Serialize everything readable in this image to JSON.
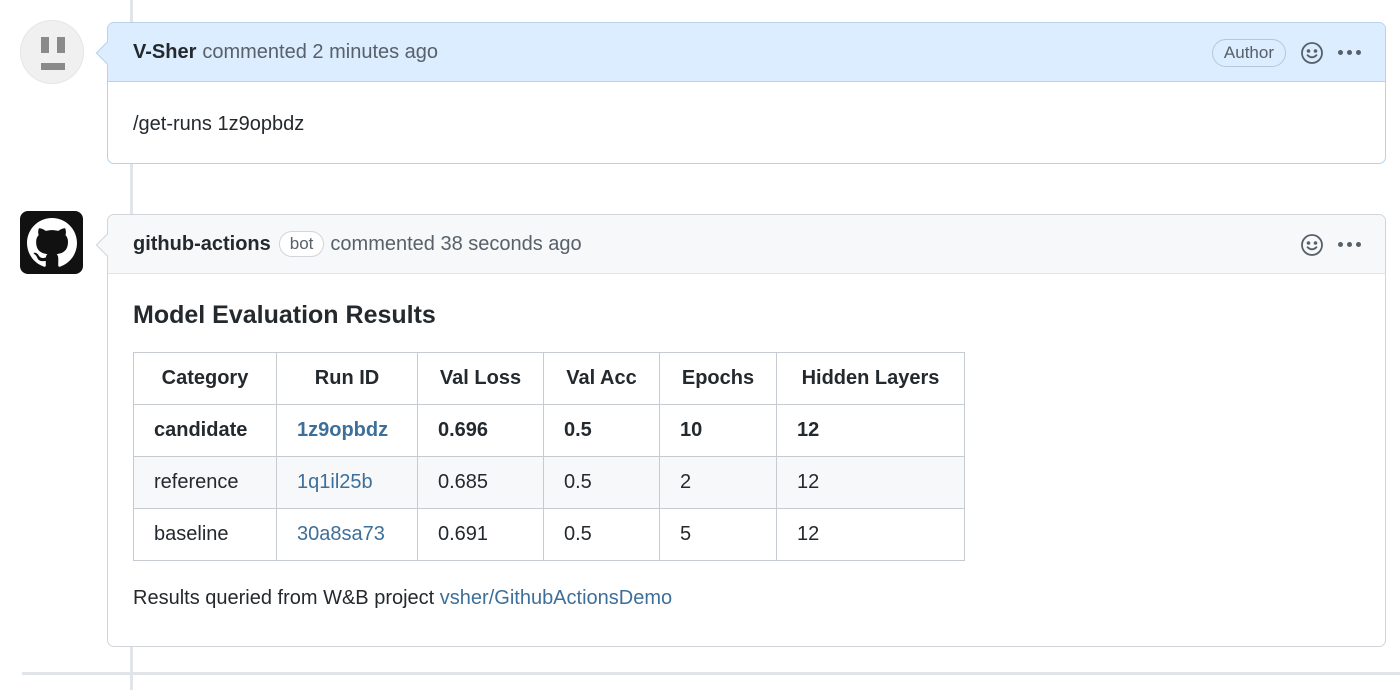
{
  "comments": [
    {
      "author": "V-Sher",
      "action": "commented 2 minutes ago",
      "role_badge": "Author",
      "body": "/get-runs 1z9opbdz"
    },
    {
      "author": "github-actions",
      "bot_badge": "bot",
      "action": "commented 38 seconds ago",
      "title": "Model Evaluation Results",
      "table": {
        "headers": [
          "Category",
          "Run ID",
          "Val Loss",
          "Val Acc",
          "Epochs",
          "Hidden Layers"
        ],
        "rows": [
          [
            "candidate",
            "1z9opbdz",
            "0.696",
            "0.5",
            "10",
            "12"
          ],
          [
            "reference",
            "1q1il25b",
            "0.685",
            "0.5",
            "2",
            "12"
          ],
          [
            "baseline",
            "30a8sa73",
            "0.691",
            "0.5",
            "5",
            "12"
          ]
        ]
      },
      "footnote_prefix": "Results queried from W&B project",
      "footnote_link": "vsher/GithubActionsDemo"
    }
  ],
  "icons": {
    "reaction": "smiley-icon",
    "menu": "kebab-horizontal-icon",
    "bot_avatar": "github-mark-icon"
  },
  "colors": {
    "author_header_bg": "#dbedff",
    "bot_header_bg": "#f6f8fa",
    "link": "#3e6f99"
  }
}
